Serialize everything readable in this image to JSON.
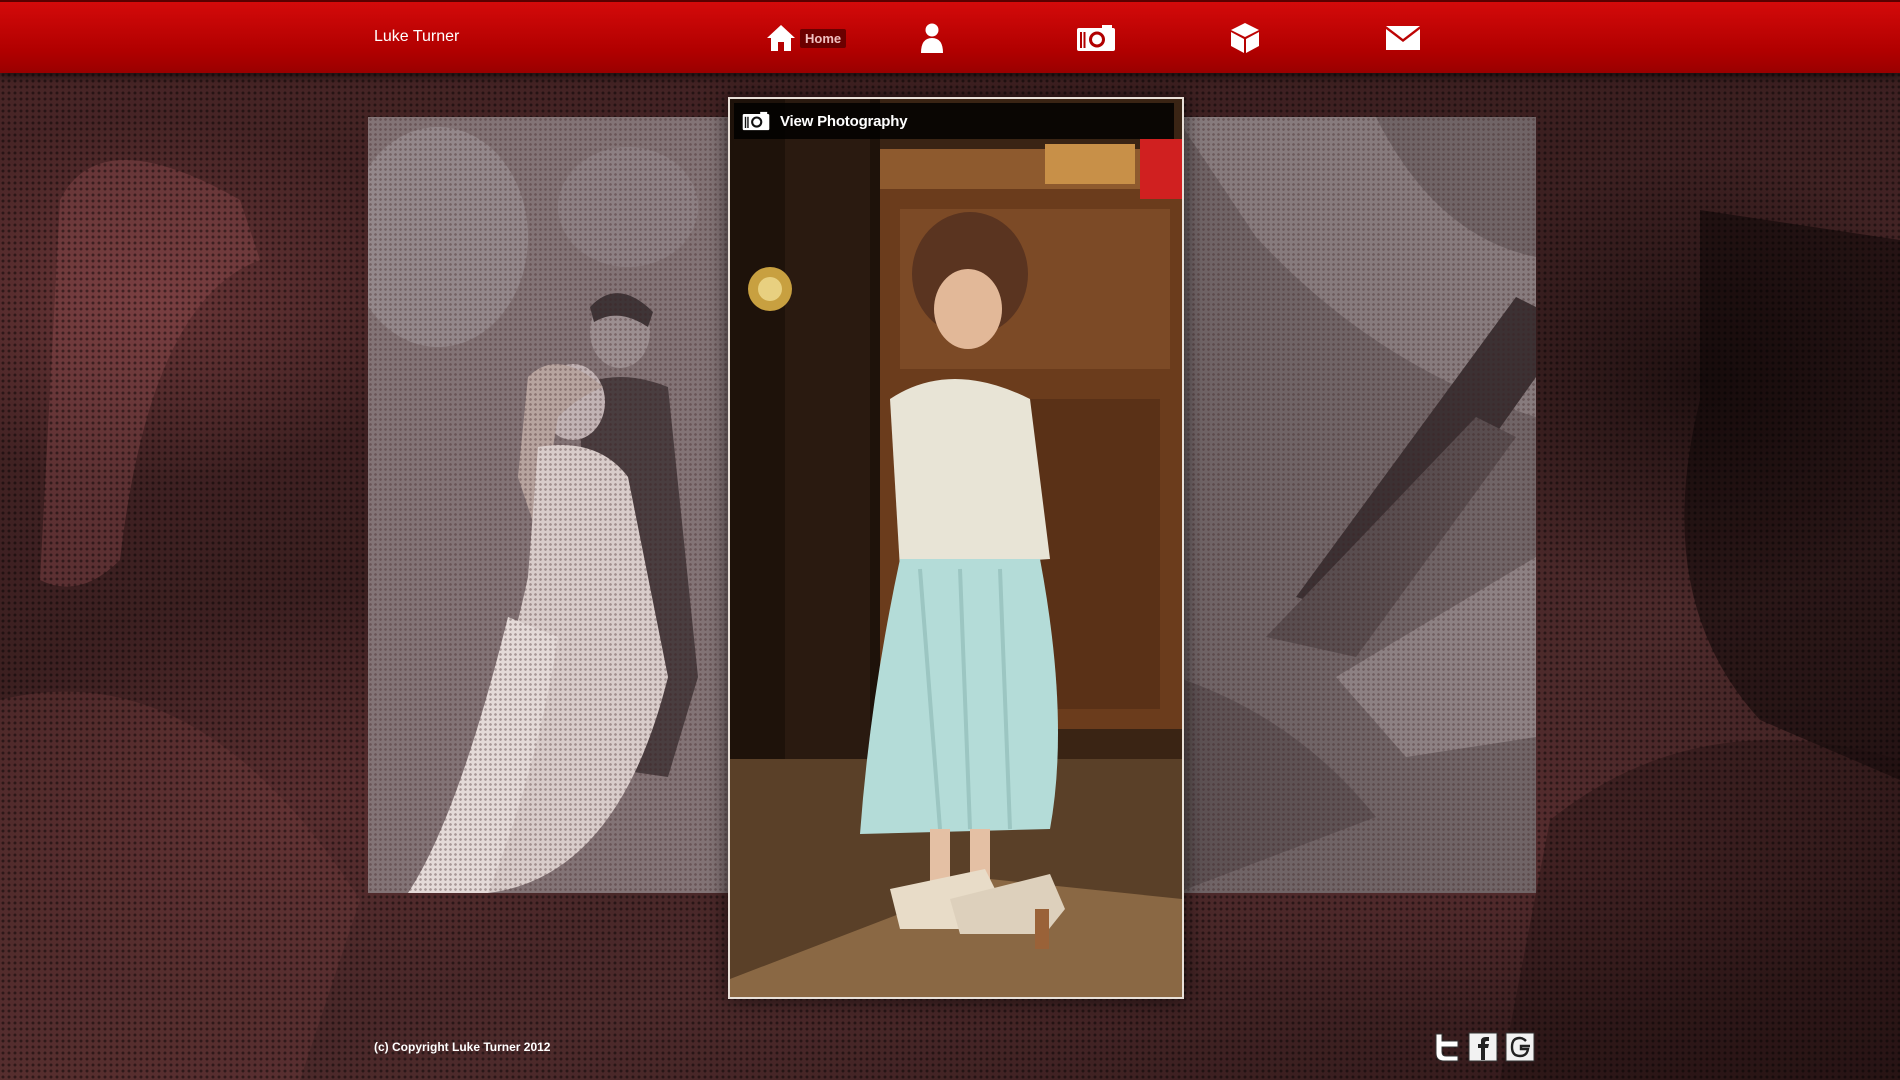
{
  "site": {
    "brand": "Luke Turner"
  },
  "nav": {
    "items": [
      {
        "id": "home",
        "label": "Home",
        "icon": "home-icon"
      },
      {
        "id": "about",
        "label": "",
        "icon": "person-icon"
      },
      {
        "id": "photography",
        "label": "",
        "icon": "camera-icon"
      },
      {
        "id": "design",
        "label": "",
        "icon": "box-icon"
      },
      {
        "id": "contact",
        "label": "",
        "icon": "mail-icon"
      }
    ]
  },
  "featured": {
    "title": "View Photography",
    "icon": "camera-icon"
  },
  "footer": {
    "copyright": "(c) Copyright Luke Turner 2012"
  },
  "social": [
    {
      "name": "twitter",
      "icon": "twitter-icon"
    },
    {
      "name": "facebook",
      "icon": "facebook-icon"
    },
    {
      "name": "google",
      "icon": "google-icon"
    }
  ],
  "colors": {
    "accent": "#c40000",
    "navbar_dark": "#9a0000",
    "badge_bg": "#6b0000"
  }
}
